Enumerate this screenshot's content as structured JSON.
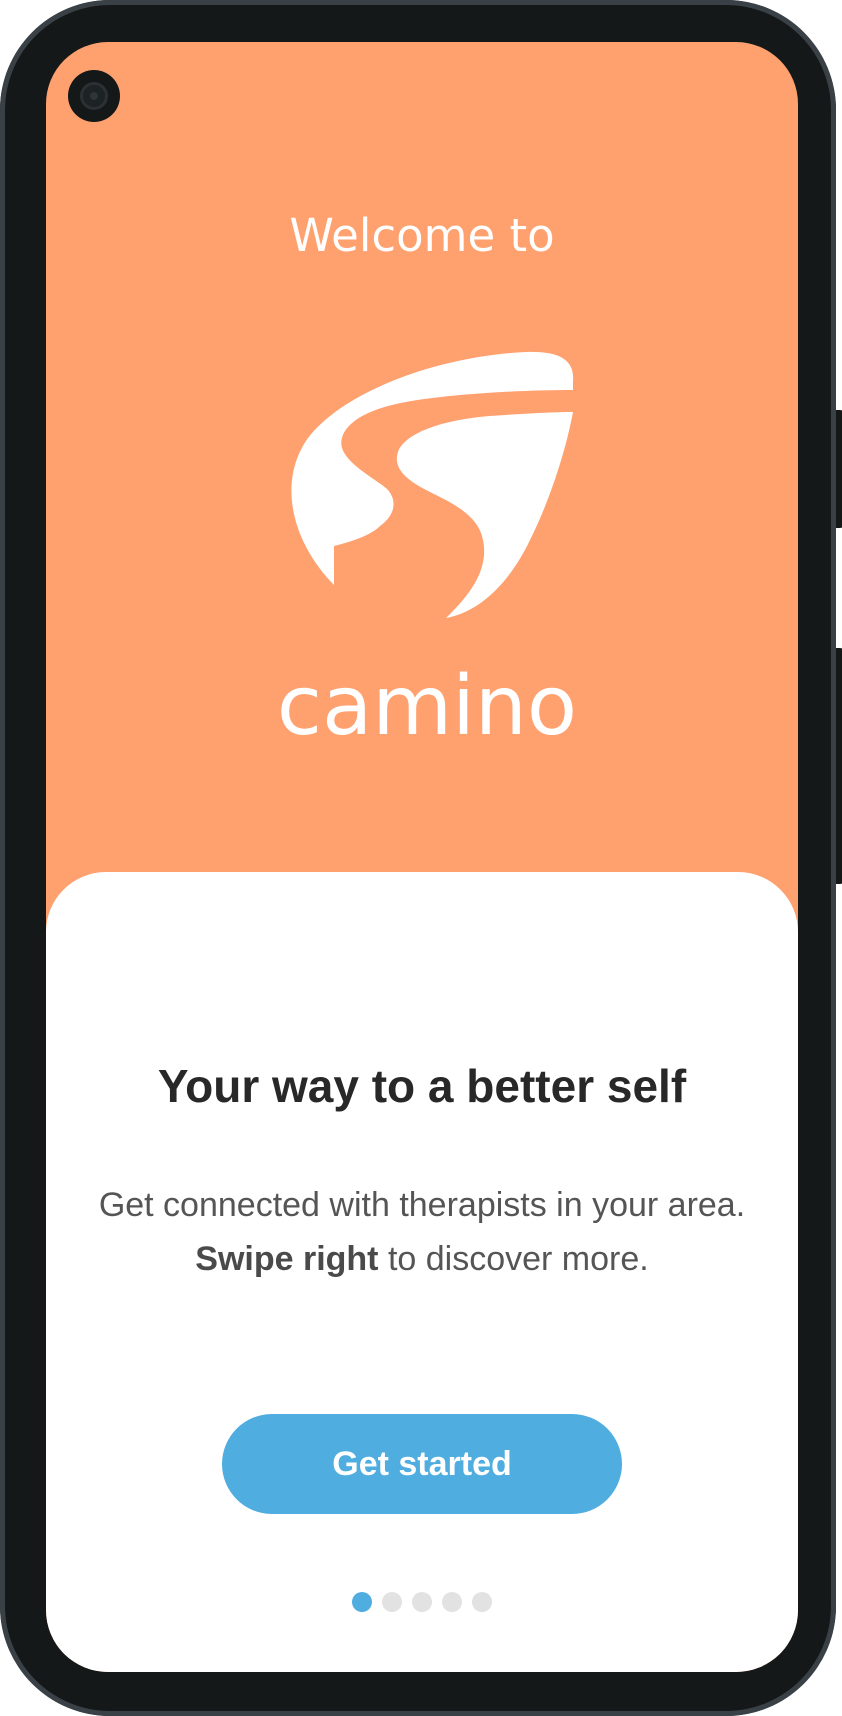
{
  "welcome": {
    "greeting": "Welcome to",
    "brand_name": "camino",
    "brand_color": "#ffa06f"
  },
  "card": {
    "headline": "Your way to a better self",
    "body_before": "Get connected with therapists in your area.",
    "body_strong": "Swipe right",
    "body_after": "to discover more."
  },
  "cta": {
    "label": "Get started",
    "color": "#4fade0"
  },
  "pager": {
    "total_pages": 5,
    "current_page": 1
  },
  "icons": {
    "camera": "front-camera-icon",
    "logo": "camino-road-logo"
  }
}
